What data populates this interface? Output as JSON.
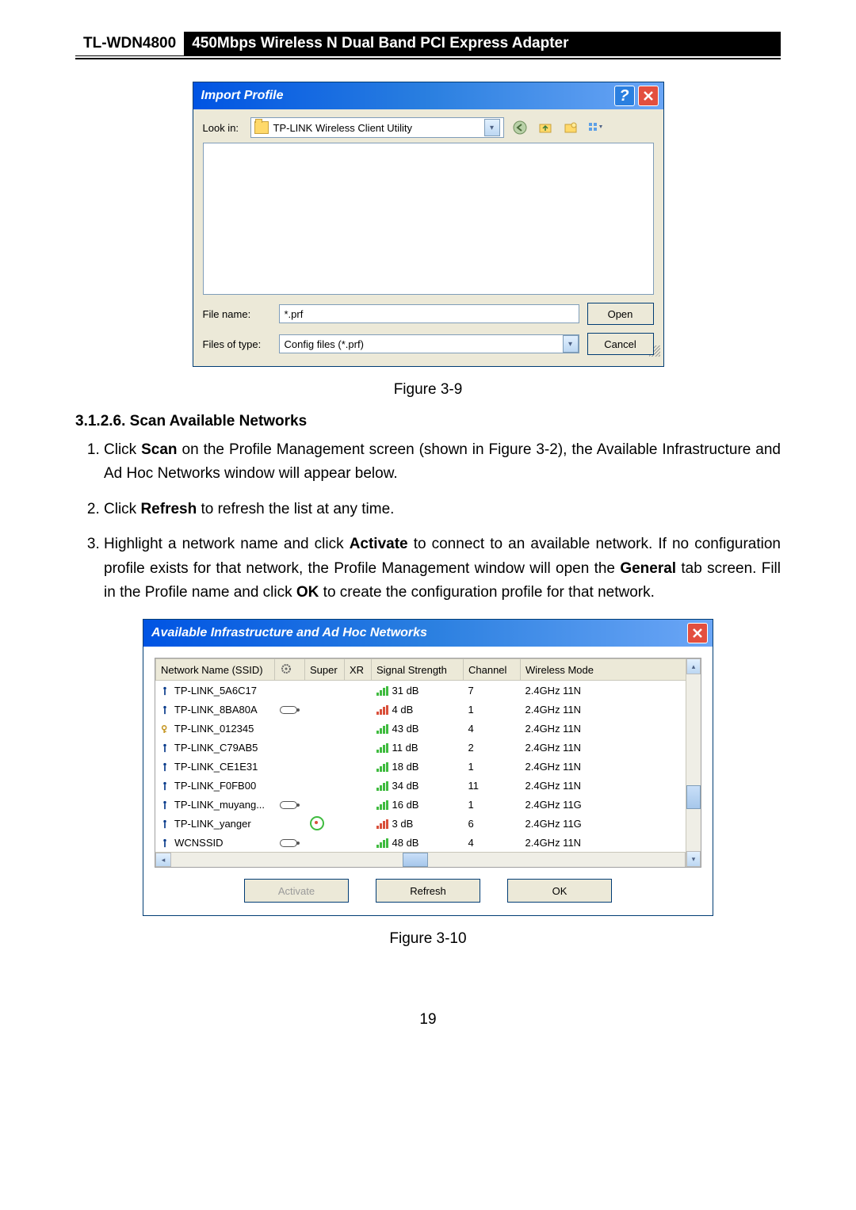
{
  "header": {
    "model": "TL-WDN4800",
    "title": "450Mbps Wireless N Dual Band PCI Express Adapter"
  },
  "fig1": {
    "title": "Import Profile",
    "lookin_label": "Look in:",
    "lookin_value": "TP-LINK Wireless Client Utility",
    "filename_label": "File name:",
    "filename_value": "*.prf",
    "filetype_label": "Files of type:",
    "filetype_value": "Config files (*.prf)",
    "open_btn": "Open",
    "cancel_btn": "Cancel",
    "caption": "Figure 3-9"
  },
  "section": {
    "heading": "3.1.2.6.  Scan Available Networks"
  },
  "steps": {
    "s1a": "Click ",
    "s1b": "Scan",
    "s1c": " on the Profile Management screen (shown in Figure 3-2), the Available Infrastructure and Ad Hoc Networks window will appear below.",
    "s2a": "Click ",
    "s2b": "Refresh",
    "s2c": " to refresh the list at any time.",
    "s3a": "Highlight a network name and click ",
    "s3b": "Activate",
    "s3c": " to connect to an available network. If no configuration profile exists for that network, the Profile Management window will open the ",
    "s3d": "General",
    "s3e": " tab screen. Fill in the Profile name and click ",
    "s3f": "OK",
    "s3g": " to create the configuration profile for that network."
  },
  "fig2": {
    "title": "Available Infrastructure and Ad Hoc Networks",
    "headers": {
      "ssid": "Network Name (SSID)",
      "gear": "",
      "super": "Super",
      "xr": "XR",
      "signal": "Signal Strength",
      "channel": "Channel",
      "mode": "Wireless Mode"
    },
    "rows": [
      {
        "icon": "i",
        "ssid": "TP-LINK_5A6C17",
        "wep": false,
        "super": false,
        "sig": "hi",
        "db": "31 dB",
        "chan": "7",
        "mode": "2.4GHz 11N"
      },
      {
        "icon": "i",
        "ssid": "TP-LINK_8BA80A",
        "wep": true,
        "super": false,
        "sig": "lo",
        "db": "4 dB",
        "chan": "1",
        "mode": "2.4GHz 11N"
      },
      {
        "icon": "key",
        "ssid": "TP-LINK_012345",
        "wep": false,
        "super": false,
        "sig": "hi",
        "db": "43 dB",
        "chan": "4",
        "mode": "2.4GHz 11N"
      },
      {
        "icon": "i",
        "ssid": "TP-LINK_C79AB5",
        "wep": false,
        "super": false,
        "sig": "hi",
        "db": "11 dB",
        "chan": "2",
        "mode": "2.4GHz 11N"
      },
      {
        "icon": "i",
        "ssid": "TP-LINK_CE1E31",
        "wep": false,
        "super": false,
        "sig": "hi",
        "db": "18 dB",
        "chan": "1",
        "mode": "2.4GHz 11N"
      },
      {
        "icon": "i",
        "ssid": "TP-LINK_F0FB00",
        "wep": false,
        "super": false,
        "sig": "hi",
        "db": "34 dB",
        "chan": "11",
        "mode": "2.4GHz 11N"
      },
      {
        "icon": "i",
        "ssid": "TP-LINK_muyang...",
        "wep": true,
        "super": false,
        "sig": "hi",
        "db": "16 dB",
        "chan": "1",
        "mode": "2.4GHz 11G"
      },
      {
        "icon": "i",
        "ssid": "TP-LINK_yanger",
        "wep": false,
        "super": true,
        "sig": "lo",
        "db": "3 dB",
        "chan": "6",
        "mode": "2.4GHz 11G"
      },
      {
        "icon": "i",
        "ssid": "WCNSSID",
        "wep": true,
        "super": false,
        "sig": "hi",
        "db": "48 dB",
        "chan": "4",
        "mode": "2.4GHz 11N"
      }
    ],
    "activate": "Activate",
    "refresh": "Refresh",
    "ok": "OK",
    "caption": "Figure 3-10"
  },
  "page_number": "19"
}
